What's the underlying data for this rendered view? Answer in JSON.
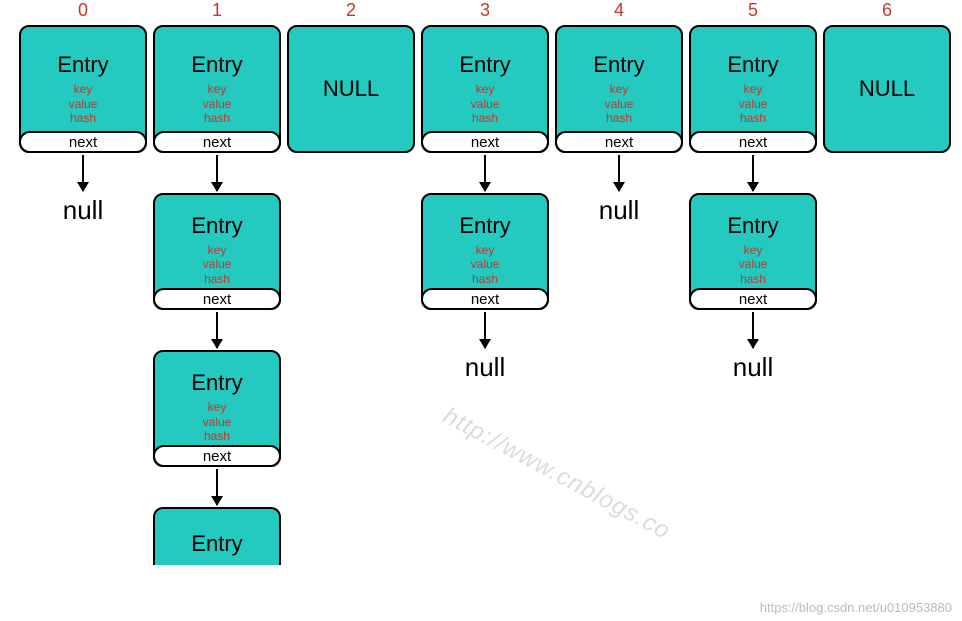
{
  "indices": [
    "0",
    "1",
    "2",
    "3",
    "4",
    "5",
    "6"
  ],
  "entry": {
    "title": "Entry",
    "fields": [
      "key",
      "value",
      "hash"
    ],
    "next": "next"
  },
  "null_bucket": "NULL",
  "null_text": "null",
  "columns": [
    {
      "top": "entry",
      "chain": [
        "null"
      ]
    },
    {
      "top": "entry",
      "chain": [
        "entry",
        "entry",
        "partial"
      ]
    },
    {
      "top": "null",
      "chain": []
    },
    {
      "top": "entry",
      "chain": [
        "entry",
        "null"
      ]
    },
    {
      "top": "entry",
      "chain": [
        "null"
      ]
    },
    {
      "top": "entry",
      "chain": [
        "entry",
        "null"
      ]
    },
    {
      "top": "null",
      "chain": []
    }
  ],
  "watermark": "http://www.cnblogs.co",
  "credit": "https://blog.csdn.net/u010953880"
}
